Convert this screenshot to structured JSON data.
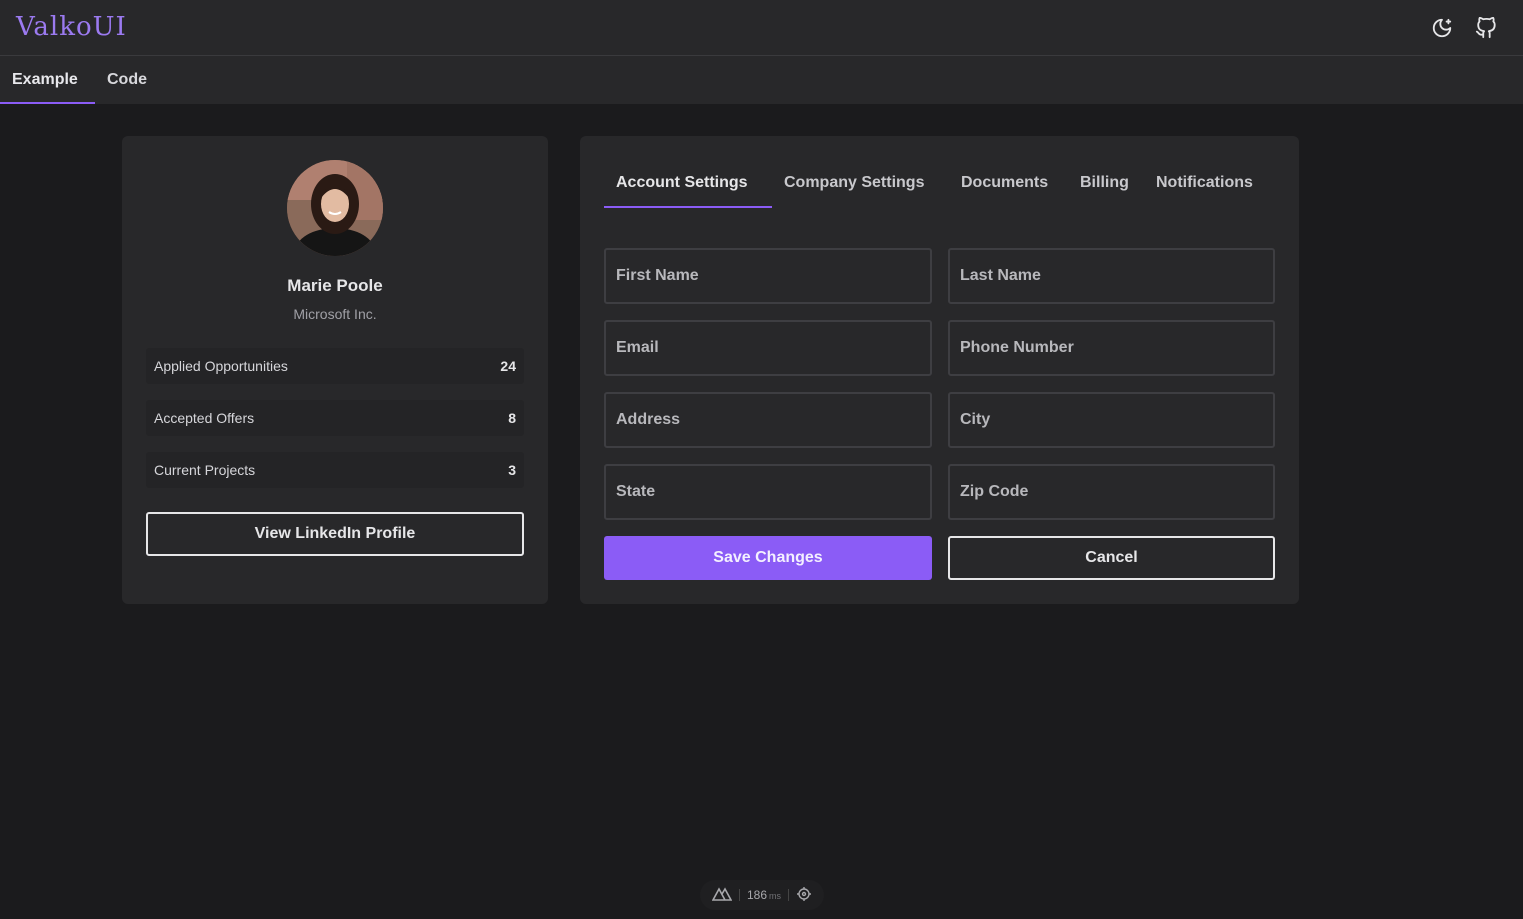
{
  "brand": "ValkoUI",
  "top_icons": [
    "moon-icon",
    "github-icon"
  ],
  "subnav": [
    {
      "label": "Example",
      "active": true
    },
    {
      "label": "Code",
      "active": false
    }
  ],
  "profile": {
    "name": "Marie Poole",
    "company": "Microsoft Inc.",
    "stats": [
      {
        "label": "Applied Opportunities",
        "value": "24"
      },
      {
        "label": "Accepted Offers",
        "value": "8"
      },
      {
        "label": "Current Projects",
        "value": "3"
      }
    ],
    "linkedin_label": "View LinkedIn Profile"
  },
  "settings": {
    "tabs": [
      {
        "label": "Account Settings",
        "active": true
      },
      {
        "label": "Company Settings",
        "active": false
      },
      {
        "label": "Documents",
        "active": false
      },
      {
        "label": "Billing",
        "active": false
      },
      {
        "label": "Notifications",
        "active": false
      }
    ],
    "fields": {
      "first_name": "First Name",
      "last_name": "Last Name",
      "email": "Email",
      "phone": "Phone Number",
      "address": "Address",
      "city": "City",
      "state": "State",
      "zip": "Zip Code"
    },
    "save_label": "Save Changes",
    "cancel_label": "Cancel"
  },
  "devbar": {
    "time": "186",
    "unit": "ms"
  },
  "colors": {
    "accent": "#8b5cf6",
    "brand": "#9b7af0",
    "background": "#1b1b1d",
    "card": "#28282a"
  }
}
